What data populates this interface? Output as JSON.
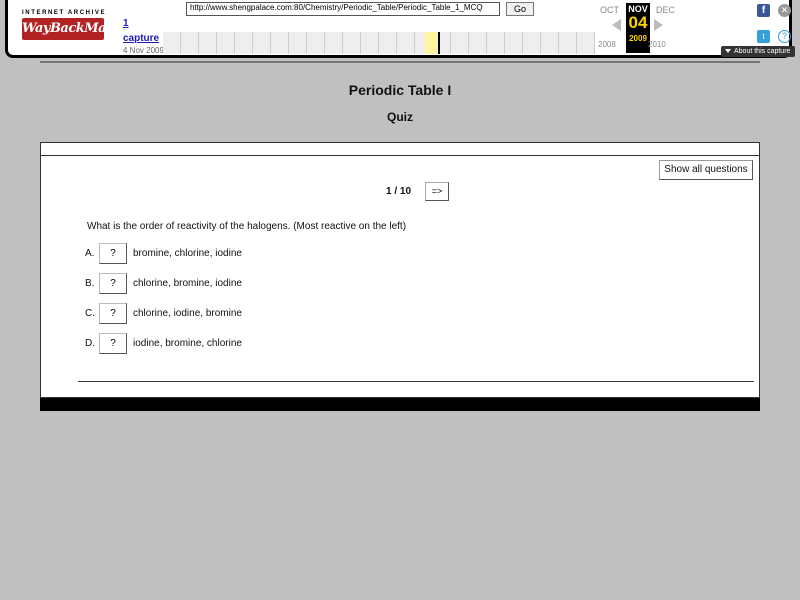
{
  "wayback": {
    "logo_top": "INTERNET ARCHIVE",
    "logo_main": "WayBackMachine",
    "url": "http://www.shengpalace.com:80/Chemistry/Periodic_Table/Periodic_Table_1_MCQ",
    "go_label": "Go",
    "capture_count": "1",
    "capture_label": "capture",
    "capture_date": "4 Nov 2009",
    "prev_month": "OCT",
    "current_month": "NOV",
    "next_month": "DEC",
    "current_day": "04",
    "prev_year": "2008",
    "current_year": "2009",
    "next_year": "2010",
    "about_label": "About this capture"
  },
  "page": {
    "title": "Periodic Table I",
    "subtitle": "Quiz"
  },
  "quiz": {
    "show_all_label": "Show all questions",
    "counter": "1 / 10",
    "next_label": "=>",
    "question": "What is the order of reactivity of the halogens. (Most reactive on the left)",
    "options": [
      {
        "letter": "A.",
        "button": "?",
        "text": "bromine, chlorine, iodine"
      },
      {
        "letter": "B.",
        "button": "?",
        "text": "chlorine, bromine, iodine"
      },
      {
        "letter": "C.",
        "button": "?",
        "text": "chlorine, iodine, bromine"
      },
      {
        "letter": "D.",
        "button": "?",
        "text": "iodine, bromine, chlorine"
      }
    ]
  }
}
